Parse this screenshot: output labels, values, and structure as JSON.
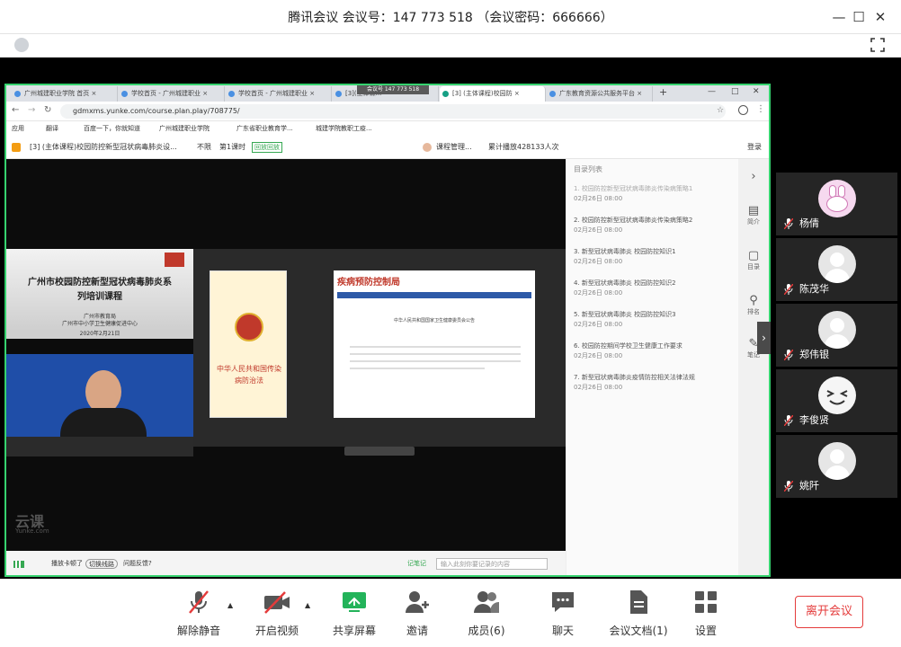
{
  "window": {
    "title": "腾讯会议 会议号：147 773 518 （会议密码：666666）"
  },
  "browser": {
    "tabs": [
      {
        "label": "广州城建职业学院 首页 ×"
      },
      {
        "label": "学校首页 - 广州城建职业 ×"
      },
      {
        "label": "学校首页 - 广州城建职业 ×"
      },
      {
        "label": "[3](主体课..."
      },
      {
        "label": "[3] (主体课程)校园防 ×"
      },
      {
        "label": "广东教育资源公共服务平台 ×"
      }
    ],
    "new_tab": "+",
    "url": "gdmxms.yunke.com/course.plan.play/708775/",
    "overlay_meeting_id": "会议号 147 773 518",
    "bookmarks": [
      "应用",
      "翻译",
      "百度一下，你就知道",
      "广州城建职业学院",
      "广东省职业教育学...",
      "城建学院教职工疫..."
    ]
  },
  "course_header": {
    "title": "[3] (主体课程)校园防控新型冠状病毒肺炎设...",
    "limit": "不限",
    "lesson": "第1课时",
    "badge": "回放回放",
    "manager": "课程管理...",
    "plays": "累计播放428133人次",
    "login": "登录"
  },
  "video": {
    "slide_title": "广州市校园防控新型冠状病毒肺炎系列培训课程",
    "org1": "广州市教育局",
    "org2": "广州市中小学卫生健康促进中心",
    "date": "2020年2月21日",
    "book_title": "中华人民共和国传染病防治法",
    "web_header": "疾病预防控制局",
    "web_notice": "中华人民共和国国家卫生健康委员会公告",
    "watermark": "云课",
    "watermark_sub": "Yunke.com"
  },
  "player_bar": {
    "signal": "信号",
    "lag": "播放卡顿了",
    "switch": "切换线路",
    "feedback": "问题反馈?",
    "notes_label": "记笔记",
    "notes_placeholder": "输入此刻你要记录的内容"
  },
  "catalog": {
    "heading": "目录列表",
    "items": [
      {
        "title": "1. 校园防控新型冠状病毒肺炎传染病策略1",
        "date": "02月26日  08:00",
        "active": true
      },
      {
        "title": "2. 校园防控新型冠状病毒肺炎传染病策略2",
        "date": "02月26日  08:00"
      },
      {
        "title": "3. 新型冠状病毒肺炎 校园防控知识1",
        "date": "02月26日  08:00"
      },
      {
        "title": "4. 新型冠状病毒肺炎 校园防控知识2",
        "date": "02月26日  08:00"
      },
      {
        "title": "5. 新型冠状病毒肺炎 校园防控知识3",
        "date": "02月26日  08:00"
      },
      {
        "title": "6. 校园防控期间学校卫生健康工作要求",
        "date": "02月26日  08:00"
      },
      {
        "title": "7. 新型冠状病毒肺炎疫情防控相关法律法规",
        "date": "02月26日  08:00"
      }
    ]
  },
  "right_nav": [
    {
      "label": "简介"
    },
    {
      "label": "目录"
    },
    {
      "label": "排名"
    },
    {
      "label": "笔记"
    }
  ],
  "taskbar_time": "9:41",
  "participants": [
    {
      "name": "杨倩",
      "avatar": "bunny-avatar"
    },
    {
      "name": "陈茂华",
      "avatar": "default-avatar"
    },
    {
      "name": "郑伟银",
      "avatar": "default-avatar"
    },
    {
      "name": "李俊贤",
      "avatar": "smiley-avatar"
    },
    {
      "name": "姚阡",
      "avatar": "default-avatar"
    }
  ],
  "toolbar": {
    "unmute": "解除静音",
    "start_video": "开启视频",
    "share_screen": "共享屏幕",
    "invite": "邀请",
    "members": "成员(6)",
    "chat": "聊天",
    "docs": "会议文档(1)",
    "settings": "设置",
    "leave": "离开会议"
  },
  "colors": {
    "accent_green": "#36d36f",
    "leave_red": "#e43b3b",
    "mute_red": "#e43b3b"
  }
}
